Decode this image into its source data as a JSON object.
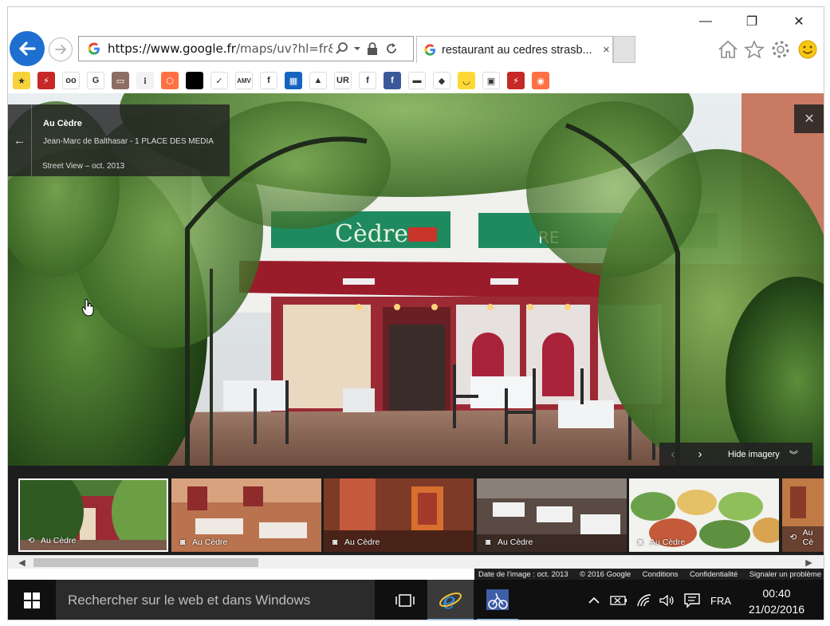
{
  "browser": {
    "url_host": "https://www.google.fr",
    "url_path": "/maps/uv?hl=fr&pb=",
    "tab_title": "restaurant au cedres strasb...",
    "tab_close": "×"
  },
  "window_controls": {
    "minimize": "—",
    "restore": "❐",
    "close": "✕"
  },
  "favorites": [
    {
      "name": "fav-star",
      "color": "#f7d23b",
      "glyph": "★"
    },
    {
      "name": "fav-1",
      "color": "#c62828",
      "glyph": "⚡"
    },
    {
      "name": "fav-tripadvisor",
      "color": "#ffffff",
      "glyph": "oo"
    },
    {
      "name": "fav-google",
      "color": "#ffffff",
      "glyph": "G"
    },
    {
      "name": "fav-4",
      "color": "#8d6e63",
      "glyph": "▭"
    },
    {
      "name": "fav-5",
      "color": "#f2f2f2",
      "glyph": "⁝"
    },
    {
      "name": "fav-6",
      "color": "#ff7043",
      "glyph": "⬡"
    },
    {
      "name": "fav-7",
      "color": "#000000",
      "glyph": ""
    },
    {
      "name": "fav-nike",
      "color": "#ffffff",
      "glyph": "✓"
    },
    {
      "name": "fav-amv",
      "color": "#ffffff",
      "glyph": "AMV"
    },
    {
      "name": "fav-f",
      "color": "#ffffff",
      "glyph": "f"
    },
    {
      "name": "fav-10",
      "color": "#1565c0",
      "glyph": "▦"
    },
    {
      "name": "fav-11",
      "color": "#ffffff",
      "glyph": "▲"
    },
    {
      "name": "fav-ur",
      "color": "#ffffff",
      "glyph": "UR"
    },
    {
      "name": "fav-13",
      "color": "#ffffff",
      "glyph": "f"
    },
    {
      "name": "fav-facebook",
      "color": "#3b5998",
      "glyph": "f"
    },
    {
      "name": "fav-15",
      "color": "#ffffff",
      "glyph": "▬"
    },
    {
      "name": "fav-16",
      "color": "#ffffff",
      "glyph": "◆"
    },
    {
      "name": "fav-17",
      "color": "#fdd835",
      "glyph": "◡"
    },
    {
      "name": "fav-18",
      "color": "#ffffff",
      "glyph": "▣"
    },
    {
      "name": "fav-19",
      "color": "#c62828",
      "glyph": "⚡"
    },
    {
      "name": "fav-20",
      "color": "#ff7043",
      "glyph": "◉"
    }
  ],
  "place": {
    "name": "Au Cèdre",
    "author": "Jean-Marc de Balthasar - 1 PLACE DES MEDIA",
    "date": "Street View – oct. 2013"
  },
  "sign": {
    "left": "Cèdre",
    "right": "RE"
  },
  "imagery": {
    "hide_label": "Hide imagery"
  },
  "thumbnails": [
    {
      "label": "Au Cèdre",
      "type": "360",
      "selected": true
    },
    {
      "label": "Au Cèdre",
      "type": "photo",
      "selected": false
    },
    {
      "label": "Au Cèdre",
      "type": "photo",
      "selected": false
    },
    {
      "label": "Au Cèdre",
      "type": "photo",
      "selected": false
    },
    {
      "label": "Au Cèdre",
      "type": "photo",
      "selected": false
    },
    {
      "label": "Au Cè",
      "type": "360",
      "selected": false
    }
  ],
  "footer": {
    "image_date": "Date de l'image : oct. 2013",
    "copyright": "© 2016 Google",
    "conditions": "Conditions",
    "privacy": "Confidentialité",
    "report": "Signaler un problème"
  },
  "taskbar": {
    "search_placeholder": "Rechercher sur le web et dans Windows",
    "language": "FRA",
    "time": "00:40",
    "date": "21/02/2016"
  },
  "colors": {
    "ie_blue": "#1e6fd0",
    "taskbar": "#101010",
    "search_bg": "#2b2b2b"
  }
}
